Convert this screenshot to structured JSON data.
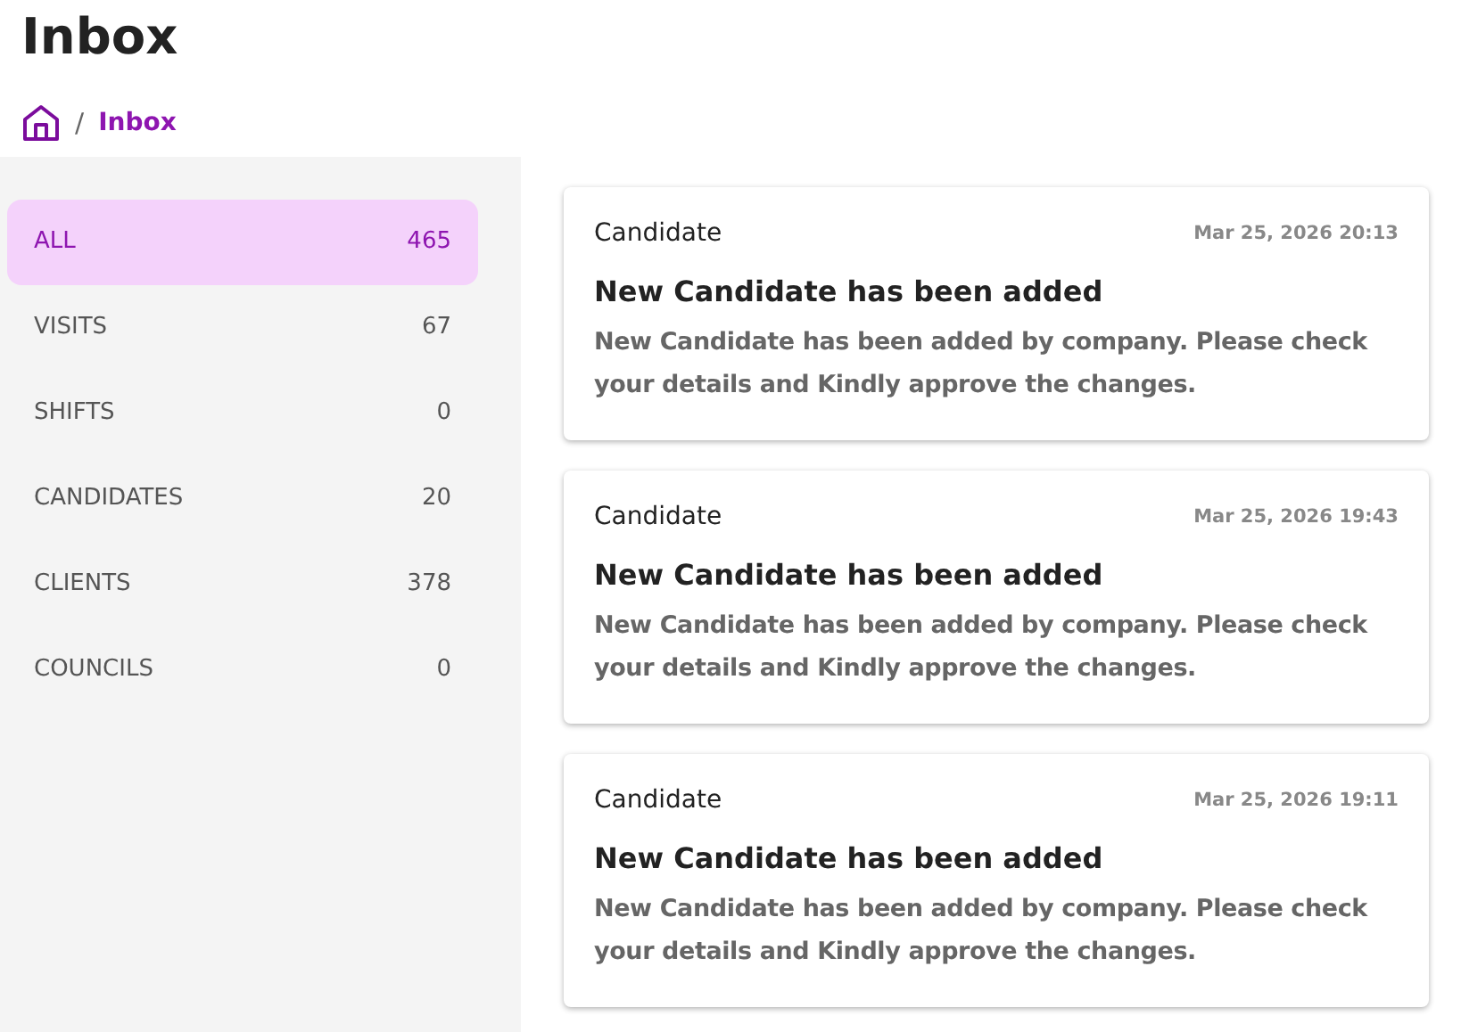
{
  "page_title": "Inbox",
  "breadcrumb": {
    "separator": "/",
    "current": "Inbox"
  },
  "sidebar": {
    "items": [
      {
        "label": "ALL",
        "count": "465",
        "selected": true
      },
      {
        "label": "VISITS",
        "count": "67",
        "selected": false
      },
      {
        "label": "SHIFTS",
        "count": "0",
        "selected": false
      },
      {
        "label": "CANDIDATES",
        "count": "20",
        "selected": false
      },
      {
        "label": "CLIENTS",
        "count": "378",
        "selected": false
      },
      {
        "label": "COUNCILS",
        "count": "0",
        "selected": false
      }
    ]
  },
  "messages": [
    {
      "category": "Candidate",
      "time": "Mar 25, 2026 20:13",
      "title": "New Candidate has been added",
      "body": "New Candidate has been added by company. Please check your details and Kindly approve the changes."
    },
    {
      "category": "Candidate",
      "time": "Mar 25, 2026 19:43",
      "title": "New Candidate has been added",
      "body": "New Candidate has been added by company. Please check your details and Kindly approve the changes."
    },
    {
      "category": "Candidate",
      "time": "Mar 25, 2026 19:11",
      "title": "New Candidate has been added",
      "body": "New Candidate has been added by company. Please check your details and Kindly approve the changes."
    }
  ]
}
